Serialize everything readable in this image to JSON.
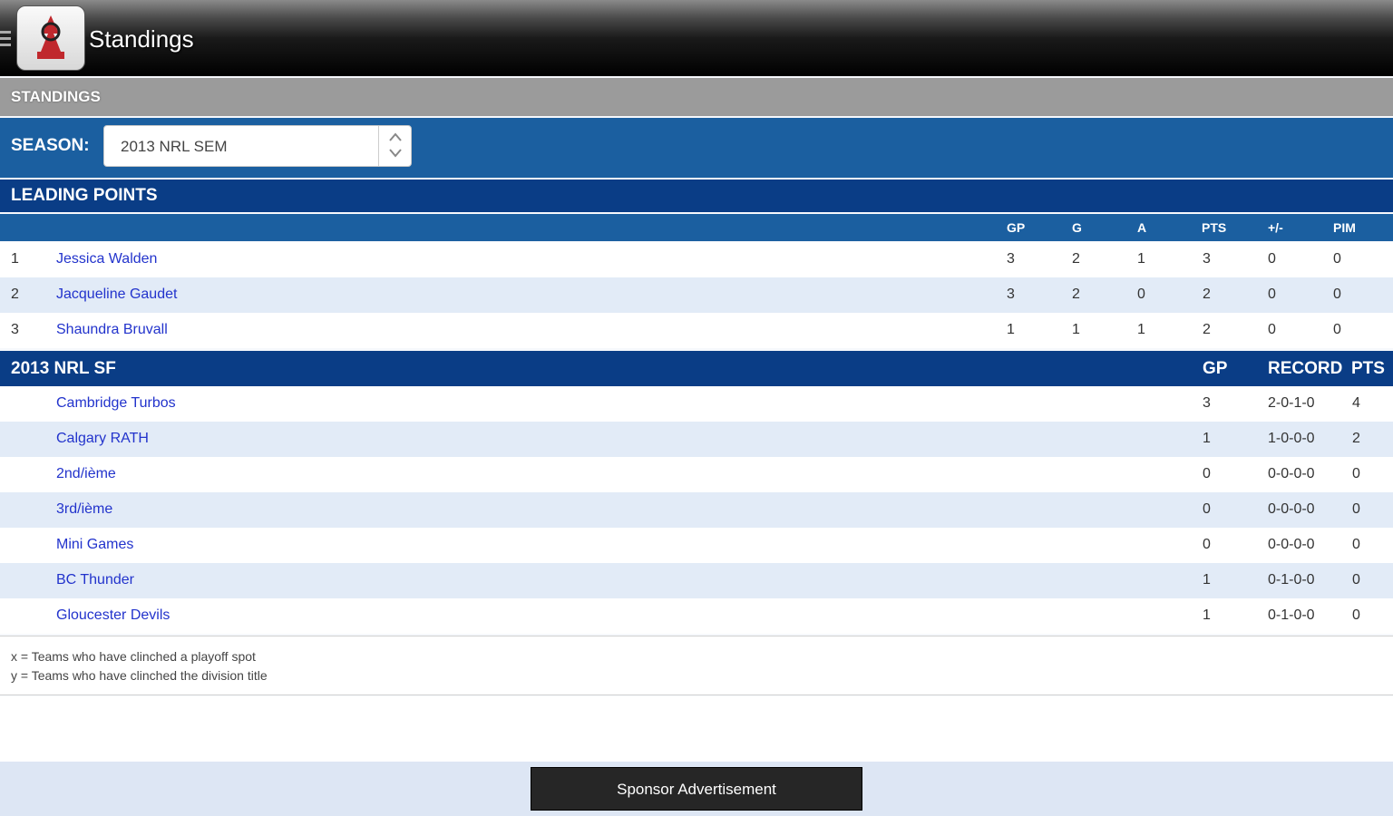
{
  "appbar": {
    "title": "Standings"
  },
  "section": {
    "header": "STANDINGS"
  },
  "season": {
    "label": "SEASON:",
    "selected": "2013 NRL SEM"
  },
  "leading_points": {
    "title": "LEADING POINTS",
    "columns": [
      "GP",
      "G",
      "A",
      "PTS",
      "+/-",
      "PIM"
    ],
    "rows": [
      {
        "rank": "1",
        "name": "Jessica Walden",
        "gp": "3",
        "g": "2",
        "a": "1",
        "pts": "3",
        "pm": "0",
        "pim": "0"
      },
      {
        "rank": "2",
        "name": "Jacqueline Gaudet",
        "gp": "3",
        "g": "2",
        "a": "0",
        "pts": "2",
        "pm": "0",
        "pim": "0"
      },
      {
        "rank": "3",
        "name": "Shaundra Bruvall",
        "gp": "1",
        "g": "1",
        "a": "1",
        "pts": "2",
        "pm": "0",
        "pim": "0"
      }
    ]
  },
  "group": {
    "title": "2013 NRL SF",
    "columns": [
      "GP",
      "RECORD",
      "PTS"
    ],
    "rows": [
      {
        "team": "Cambridge Turbos",
        "gp": "3",
        "record": "2-0-1-0",
        "pts": "4"
      },
      {
        "team": "Calgary RATH",
        "gp": "1",
        "record": "1-0-0-0",
        "pts": "2"
      },
      {
        "team": "2nd/ième",
        "gp": "0",
        "record": "0-0-0-0",
        "pts": "0"
      },
      {
        "team": "3rd/ième",
        "gp": "0",
        "record": "0-0-0-0",
        "pts": "0"
      },
      {
        "team": "Mini Games",
        "gp": "0",
        "record": "0-0-0-0",
        "pts": "0"
      },
      {
        "team": "BC Thunder",
        "gp": "1",
        "record": "0-1-0-0",
        "pts": "0"
      },
      {
        "team": "Gloucester Devils",
        "gp": "1",
        "record": "0-1-0-0",
        "pts": "0"
      }
    ]
  },
  "legend": {
    "x": "x = Teams who have clinched a playoff spot",
    "y": "y = Teams who have clinched the division title"
  },
  "sponsor": {
    "label": "Sponsor Advertisement"
  }
}
